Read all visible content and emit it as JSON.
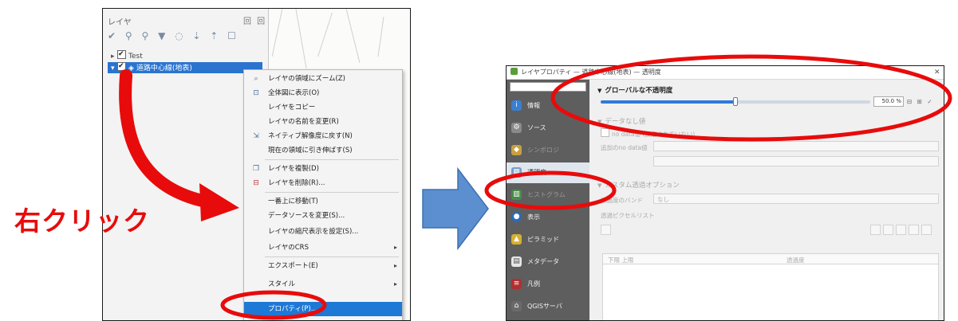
{
  "left_screenshot": {
    "panel_title": "レイヤ",
    "panel_right_icons": "回 回",
    "toolbar_icons": "✔ ⚲ ⚲ ▼ ◌ ⇣ ⇡ ☐",
    "tree": {
      "root_label": "Test",
      "layer_label": "道路中心線(地表)"
    },
    "context_menu": {
      "items": [
        {
          "label": "レイヤの領域にズーム(Z)",
          "icon": "zoom-icon"
        },
        {
          "label": "全体図に表示(O)",
          "icon": "overview-icon"
        },
        {
          "label": "レイヤをコピー",
          "icon": ""
        },
        {
          "label": "レイヤの名前を変更(R)",
          "icon": ""
        },
        {
          "label": "ネイティブ解像度に戻す(N)",
          "icon": "native-resolution-icon"
        },
        {
          "label": "現在の領域に引き伸ばす(S)",
          "icon": ""
        },
        {
          "label": "レイヤを複製(D)",
          "icon": "duplicate-layer-icon"
        },
        {
          "label": "レイヤを削除(R)...",
          "icon": "remove-layer-icon"
        },
        {
          "label": "一番上に移動(T)",
          "icon": ""
        },
        {
          "label": "データソースを変更(S)...",
          "icon": ""
        },
        {
          "label": "レイヤの縮尺表示を設定(S)...",
          "icon": ""
        },
        {
          "label": "レイヤのCRS",
          "icon": ""
        },
        {
          "label": "エクスポート(E)",
          "icon": ""
        },
        {
          "label": "スタイル",
          "icon": ""
        },
        {
          "label": "プロパティ(P)...",
          "icon": ""
        }
      ]
    }
  },
  "right_screenshot": {
    "window_title": "レイヤプロパティ — 道路中心線(地表) — 透明度",
    "close_glyph": "✕",
    "sidebar_items": [
      {
        "label": "情報",
        "icon": "info-icon"
      },
      {
        "label": "ソース",
        "icon": "source-icon"
      },
      {
        "label": "シンボロジ",
        "icon": "symbology-icon"
      },
      {
        "label": "透明度",
        "icon": "transparency-icon"
      },
      {
        "label": "ヒストグラム",
        "icon": "histogram-icon"
      },
      {
        "label": "表示",
        "icon": "rendering-icon"
      },
      {
        "label": "ピラミッド",
        "icon": "pyramids-icon"
      },
      {
        "label": "メタデータ",
        "icon": "metadata-icon"
      },
      {
        "label": "凡例",
        "icon": "legend-icon"
      },
      {
        "label": "QGISサーバ",
        "icon": "qgis-server-icon"
      }
    ],
    "global_opacity_title": "グローバルな不透明度",
    "opacity_value": "50.0 %",
    "opacity_fraction": 0.5,
    "spin_controls": "⊟ ⊞ ✓",
    "nodata_title": "データなし値",
    "nodata_checkbox": "no data値 (設定されていない)",
    "extra_nodata_label": "追加のno data値",
    "custom_options_title": "カスタム透過オプション",
    "transparency_band_label": "透過度のバンド",
    "transparency_band_value": "なし",
    "transparent_pixels_label": "透過ピクセルリスト",
    "table_headers": [
      "下限 上限",
      "透過度"
    ]
  },
  "annotations": {
    "right_click_label": "右クリック",
    "accent_color": "#e80b0b",
    "arrow_color": "#5b8fd0"
  }
}
